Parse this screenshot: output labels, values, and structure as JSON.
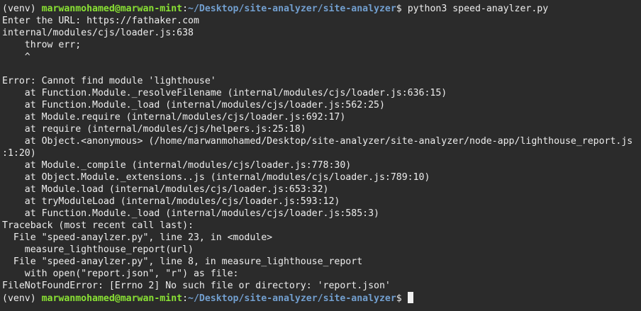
{
  "colors": {
    "background": "#2b2b2b",
    "text": "#ededed",
    "user_host": "#8ae234",
    "path": "#729fcf"
  },
  "prompt": {
    "venv": "(venv) ",
    "user_host": "marwanmohamed@marwan-mint",
    "separator": ":",
    "path": "~/Desktop/site-analyzer/site-analyzer",
    "symbol": "$ ",
    "command": "python3 speed-anaylzer.py"
  },
  "output_lines": [
    "Enter the URL: https://fathaker.com",
    "internal/modules/cjs/loader.js:638",
    "    throw err;",
    "    ^",
    "",
    "Error: Cannot find module 'lighthouse'",
    "    at Function.Module._resolveFilename (internal/modules/cjs/loader.js:636:15)",
    "    at Function.Module._load (internal/modules/cjs/loader.js:562:25)",
    "    at Module.require (internal/modules/cjs/loader.js:692:17)",
    "    at require (internal/modules/cjs/helpers.js:25:18)",
    "    at Object.<anonymous> (/home/marwanmohamed/Desktop/site-analyzer/site-analyzer/node-app/lighthouse_report.js",
    ":1:20)",
    "    at Module._compile (internal/modules/cjs/loader.js:778:30)",
    "    at Object.Module._extensions..js (internal/modules/cjs/loader.js:789:10)",
    "    at Module.load (internal/modules/cjs/loader.js:653:32)",
    "    at tryModuleLoad (internal/modules/cjs/loader.js:593:12)",
    "    at Function.Module._load (internal/modules/cjs/loader.js:585:3)",
    "Traceback (most recent call last):",
    "  File \"speed-anaylzer.py\", line 23, in <module>",
    "    measure_lighthouse_report(url)",
    "  File \"speed-anaylzer.py\", line 8, in measure_lighthouse_report",
    "    with open(\"report.json\", \"r\") as file:",
    "FileNotFoundError: [Errno 2] No such file or directory: 'report.json'"
  ],
  "final_prompt": {
    "venv": "(venv) ",
    "user_host": "marwanmohamed@marwan-mint",
    "separator": ":",
    "path": "~/Desktop/site-analyzer/site-analyzer",
    "symbol": "$ "
  }
}
